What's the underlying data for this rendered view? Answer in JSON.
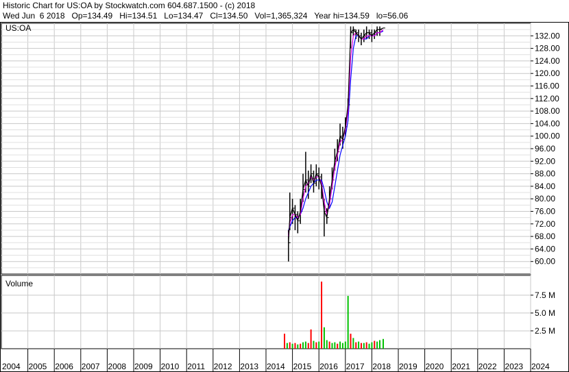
{
  "header": {
    "line1": "Historic Chart for US:OA by Stockwatch.com 604.687.1500 - (c) 2018",
    "line2": "Wed Jun  6 2018   Op=134.49   Hi=134.51   Lo=134.47   Cl=134.50   Vol=1,365,324   Year hi=134.59   lo=56.06"
  },
  "chart_data": [
    {
      "type": "line",
      "title": "US:OA",
      "ylim": [
        56,
        136
      ],
      "y_ticks": [
        "60.00",
        "64.00",
        "68.00",
        "72.00",
        "76.00",
        "80.00",
        "84.00",
        "88.00",
        "92.00",
        "96.00",
        "100.00",
        "104.00",
        "108.00",
        "112.00",
        "116.00",
        "120.00",
        "124.00",
        "128.00",
        "132.00"
      ],
      "grid": true,
      "series": [
        {
          "color": "#000000",
          "style": "price bars"
        },
        {
          "color": "#e000e0",
          "style": "short moving average"
        },
        {
          "color": "#0000ff",
          "style": "long moving average"
        }
      ],
      "x": [
        2014.85,
        2014.9,
        2015.0,
        2015.1,
        2015.2,
        2015.3,
        2015.4,
        2015.5,
        2015.6,
        2015.7,
        2015.8,
        2015.9,
        2016.0,
        2016.1,
        2016.2,
        2016.3,
        2016.4,
        2016.5,
        2016.6,
        2016.7,
        2016.8,
        2016.9,
        2017.0,
        2017.1,
        2017.2,
        2017.3,
        2017.4,
        2017.5,
        2017.6,
        2017.7,
        2017.8,
        2017.9,
        2018.0,
        2018.1,
        2018.2,
        2018.3,
        2018.43
      ],
      "close": [
        66,
        74,
        77,
        75,
        73,
        76,
        83,
        86,
        84,
        88,
        85,
        88,
        87,
        84,
        76,
        74,
        80,
        86,
        92,
        95,
        100,
        99,
        103,
        110,
        133,
        134,
        133,
        132,
        131,
        132,
        133,
        133,
        132,
        133,
        134,
        134,
        134.5
      ],
      "high": [
        70,
        82,
        80,
        78,
        76,
        80,
        88,
        95,
        89,
        91,
        89,
        91,
        90,
        88,
        80,
        77,
        84,
        90,
        96,
        99,
        104,
        103,
        106,
        112,
        135,
        135,
        134,
        134,
        133,
        134,
        135,
        134,
        134,
        134,
        135,
        135,
        134.6
      ],
      "low": [
        60,
        70,
        72,
        70,
        69,
        72,
        79,
        82,
        80,
        85,
        82,
        84,
        83,
        80,
        68,
        72,
        77,
        83,
        89,
        92,
        97,
        96,
        100,
        107,
        128,
        132,
        131,
        130,
        129,
        130,
        131,
        131,
        130,
        131,
        132,
        132,
        134.4
      ],
      "ma_short": [
        68,
        72,
        75,
        75,
        74,
        75,
        80,
        84,
        85,
        87,
        86,
        87,
        87,
        85,
        79,
        75,
        78,
        84,
        90,
        94,
        98,
        99,
        102,
        108,
        125,
        132,
        133,
        132,
        131,
        131,
        132,
        132,
        132,
        132,
        133,
        133,
        134
      ],
      "ma_long": [
        70,
        71,
        73,
        74,
        74,
        75,
        77,
        80,
        82,
        84,
        85,
        86,
        86,
        86,
        83,
        79,
        77,
        79,
        84,
        89,
        94,
        97,
        100,
        105,
        118,
        128,
        132,
        132,
        131,
        131,
        131,
        132,
        132,
        132,
        133,
        133,
        133.5
      ]
    },
    {
      "type": "bar",
      "title": "Volume",
      "ylim": [
        0,
        9500000
      ],
      "y_ticks": [
        "2.5 M",
        "5.0 M",
        "7.5 M"
      ],
      "y_tick_values": [
        2500000,
        5000000,
        7500000
      ],
      "colors": {
        "up": "#00c000",
        "down": "#ff0000"
      },
      "x": [
        2014.7,
        2014.8,
        2014.9,
        2015.0,
        2015.1,
        2015.2,
        2015.3,
        2015.4,
        2015.5,
        2015.6,
        2015.7,
        2015.8,
        2015.9,
        2016.0,
        2016.1,
        2016.2,
        2016.3,
        2016.4,
        2016.5,
        2016.6,
        2016.7,
        2016.8,
        2016.9,
        2017.0,
        2017.1,
        2017.2,
        2017.3,
        2017.4,
        2017.5,
        2017.6,
        2017.7,
        2017.8,
        2017.9,
        2018.0,
        2018.1,
        2018.2,
        2018.3,
        2018.43
      ],
      "values": [
        2100000,
        800000,
        900000,
        700000,
        800000,
        600000,
        700000,
        900000,
        1000000,
        800000,
        2700000,
        1100000,
        900000,
        1000000,
        9400000,
        3000000,
        1200000,
        1000000,
        800000,
        900000,
        700000,
        1000000,
        800000,
        1000000,
        7400000,
        2100000,
        1500000,
        900000,
        1000000,
        800000,
        800000,
        900000,
        700000,
        900000,
        1100000,
        1000000,
        1200000,
        1365324
      ],
      "direction": [
        "d",
        "u",
        "d",
        "u",
        "d",
        "u",
        "d",
        "u",
        "u",
        "d",
        "d",
        "u",
        "d",
        "u",
        "d",
        "u",
        "u",
        "d",
        "u",
        "u",
        "d",
        "u",
        "u",
        "u",
        "u",
        "d",
        "u",
        "d",
        "u",
        "d",
        "u",
        "d",
        "u",
        "u",
        "d",
        "u",
        "u",
        "u"
      ]
    }
  ],
  "x_axis": {
    "labels": [
      "2004",
      "2005",
      "2006",
      "2007",
      "2008",
      "2009",
      "2010",
      "2011",
      "2012",
      "2013",
      "2014",
      "2015",
      "2016",
      "2017",
      "2018",
      "2019",
      "2020",
      "2021",
      "2022",
      "2023",
      "2024"
    ]
  }
}
